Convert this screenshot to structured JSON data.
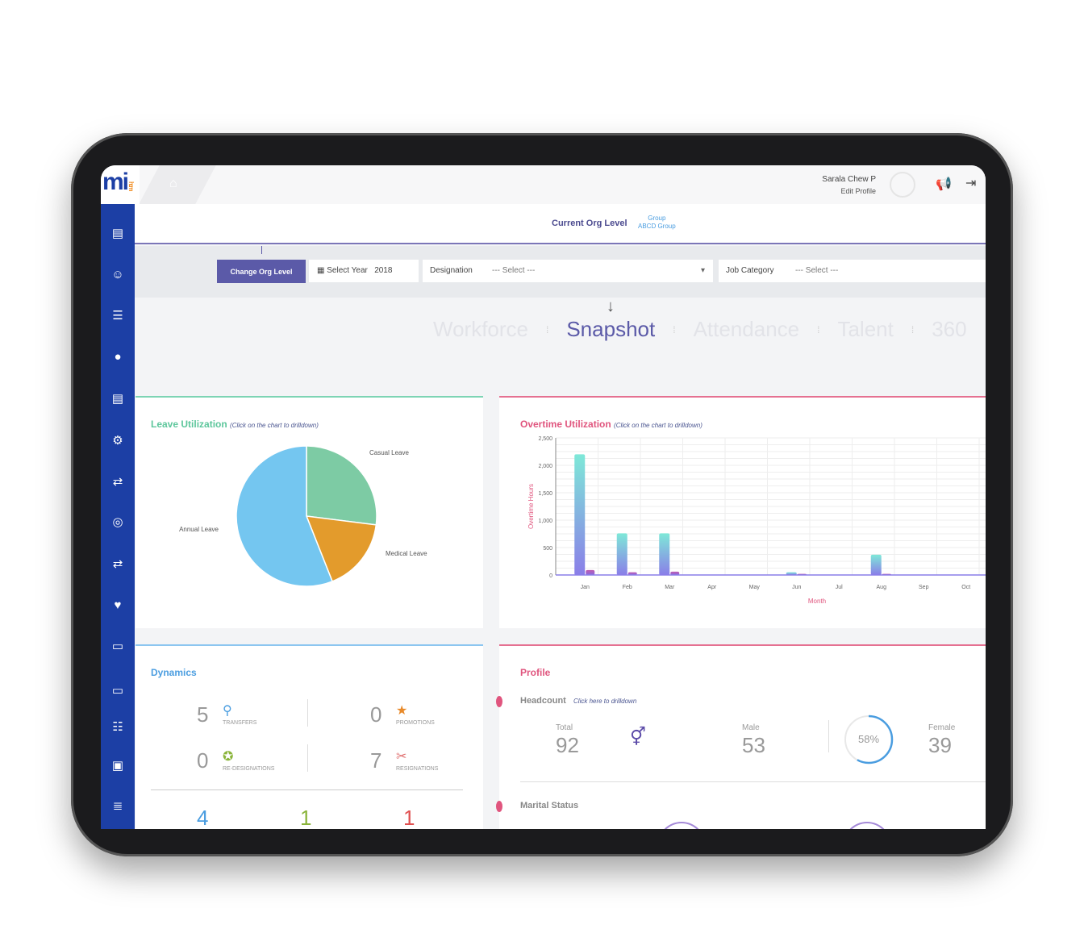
{
  "header": {
    "user_name": "Sarala Chew P",
    "edit_profile": "Edit Profile",
    "icons": [
      "home-icon",
      "megaphone-icon",
      "logout-icon"
    ]
  },
  "logo": {
    "text": "mi",
    "suffix": "hcm"
  },
  "sidebar": {
    "icons": [
      "form-icon",
      "employee-icon",
      "list-icon",
      "user-icon",
      "form-icon",
      "user-settings-icon",
      "user-switch-icon",
      "fingerprint-icon",
      "user-switch-icon",
      "heart-hand-icon",
      "payment-icon",
      "payment-icon",
      "group-icon",
      "document-icon",
      "checklist-icon"
    ]
  },
  "org": {
    "label": "Current Org Level",
    "level_type": "Group",
    "level_name": "ABCD Group"
  },
  "filters": {
    "change_button": "Change Org Level",
    "year_label": "Select Year",
    "year_value": "2018",
    "designation_label": "Designation",
    "designation_value": "--- Select ---",
    "job_category_label": "Job Category",
    "job_category_value": "--- Select ---"
  },
  "tabs": [
    "Workforce",
    "Snapshot",
    "Attendance",
    "Talent",
    "360"
  ],
  "active_tab": "Snapshot",
  "leave": {
    "title": "Leave Utilization",
    "hint": "(Click on the chart to drilldown)"
  },
  "overtime": {
    "title": "Overtime Utilization",
    "hint": "(Click on the chart to drilldown)"
  },
  "chart_data": [
    {
      "type": "pie",
      "categories": [
        "Casual Leave",
        "Medical Leave",
        "Annual Leave"
      ],
      "values": [
        27,
        17,
        56
      ],
      "colors": [
        "#7dcba4",
        "#e39b2c",
        "#74c6f0"
      ]
    },
    {
      "type": "bar",
      "xlabel": "Month",
      "ylabel": "Overtime Hours",
      "categories": [
        "Jan",
        "Feb",
        "Mar",
        "Apr",
        "May",
        "Jun",
        "Jul",
        "Aug",
        "Sep",
        "Oct"
      ],
      "ylim": [
        0,
        2500
      ],
      "yticks": [
        "0",
        "500",
        "1,000",
        "1,500",
        "2,000",
        "2,500"
      ],
      "ytick_values": [
        0,
        500,
        1000,
        1500,
        2000,
        2500
      ],
      "grid": true,
      "series": [
        {
          "values": [
            2200,
            760,
            760,
            0,
            0,
            50,
            0,
            370,
            0,
            0
          ],
          "colors": [
            "#7ee8d8",
            "#8a7ee8"
          ]
        },
        {
          "values": [
            90,
            50,
            60,
            0,
            0,
            20,
            0,
            20,
            0,
            0
          ],
          "colors": [
            "#c05bb0",
            "#8a6ae0"
          ]
        }
      ]
    }
  ],
  "dynamics": {
    "title": "Dynamics",
    "items": [
      {
        "value": "5",
        "label": "TRANSFERS",
        "icon": "transfer-icon",
        "color": "#4a9de0"
      },
      {
        "value": "0",
        "label": "PROMOTIONS",
        "icon": "promotion-star-icon",
        "color": "#e88a2a"
      },
      {
        "value": "0",
        "label": "RE-DESIGNATIONS",
        "icon": "medal-icon",
        "color": "#8ab43a"
      },
      {
        "value": "7",
        "label": "RESIGNATIONS",
        "icon": "resignation-icon",
        "color": "#e07070"
      }
    ],
    "bottom": [
      {
        "value": "4",
        "color": "#4a9de0"
      },
      {
        "value": "1",
        "color": "#8ab43a"
      },
      {
        "value": "1",
        "color": "#e05050"
      }
    ]
  },
  "profile": {
    "title": "Profile",
    "headcount": "Headcount",
    "hint": "Click here to drilldown",
    "total_label": "Total",
    "total": "92",
    "male_label": "Male",
    "male": "53",
    "female_label": "Female",
    "female": "39",
    "percent": "58%",
    "percent_value": 58,
    "marital": "Marital Status"
  }
}
